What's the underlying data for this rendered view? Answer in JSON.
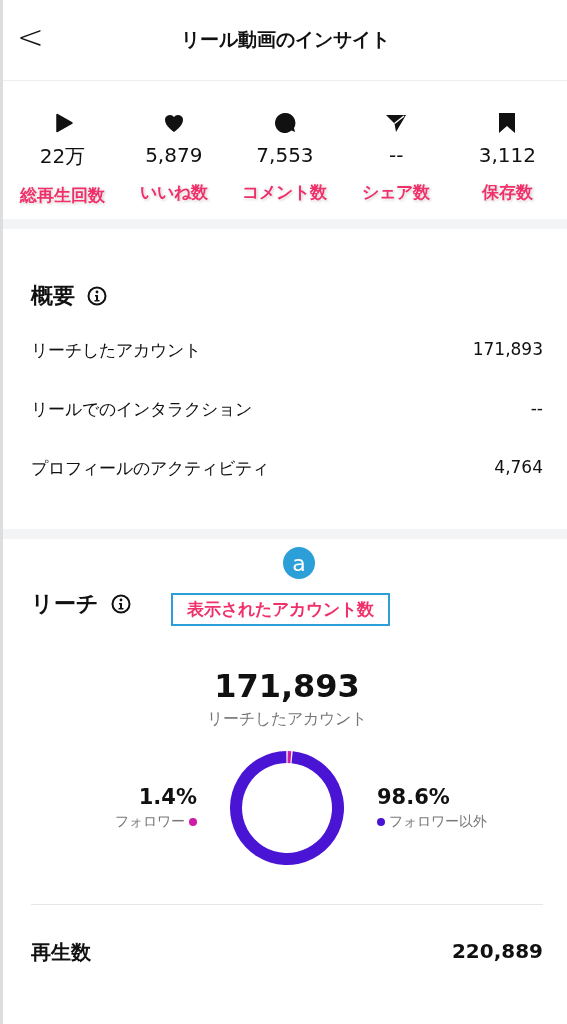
{
  "header": {
    "back": "<",
    "title": "リール動画のインサイト"
  },
  "stats": [
    {
      "kind": "play",
      "value": "22万",
      "annotation": "総再生回数"
    },
    {
      "kind": "like",
      "value": "5,879",
      "annotation": "いいね数"
    },
    {
      "kind": "comment",
      "value": "7,553",
      "annotation": "コメント数"
    },
    {
      "kind": "share",
      "value": "--",
      "annotation": "シェア数"
    },
    {
      "kind": "save",
      "value": "3,112",
      "annotation": "保存数"
    }
  ],
  "overview": {
    "title": "概要",
    "rows": [
      {
        "label": "リーチしたアカウント",
        "value": "171,893"
      },
      {
        "label": "リールでのインタラクション",
        "value": "--"
      },
      {
        "label": "プロフィールのアクティビティ",
        "value": "4,764"
      }
    ]
  },
  "reach": {
    "title": "リーチ",
    "callout": {
      "marker": "a",
      "text": "表示されたアカウント数"
    },
    "total": "171,893",
    "total_label": "リーチしたアカウント",
    "legend": [
      {
        "percent": "1.4%",
        "color": "#d01aa8"
      },
      {
        "percent": "98.6%",
        "color": "#4a14d4"
      }
    ],
    "chart_data": {
      "type": "donut",
      "categories": [
        "フォロワー",
        "フォロワー以外"
      ],
      "values": [
        1.4,
        98.6
      ]
    }
  },
  "plays": {
    "label": "再生数",
    "value": "220,889"
  }
}
